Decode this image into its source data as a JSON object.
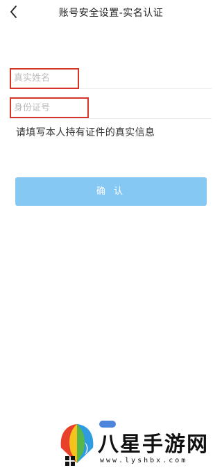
{
  "header": {
    "back_icon": "chevron-left-icon",
    "title": "账号安全设置-实名认证"
  },
  "form": {
    "name_placeholder": "真实姓名",
    "name_value": "",
    "id_placeholder": "身份证号",
    "id_value": "",
    "hint": "请填写本人持有证件的真实信息",
    "confirm_label": "确 认"
  },
  "watermark": {
    "brand": "八星手游网",
    "url": "www.lyshbx.com"
  },
  "colors": {
    "highlight": "#d8352a",
    "button": "#86c8f4"
  }
}
